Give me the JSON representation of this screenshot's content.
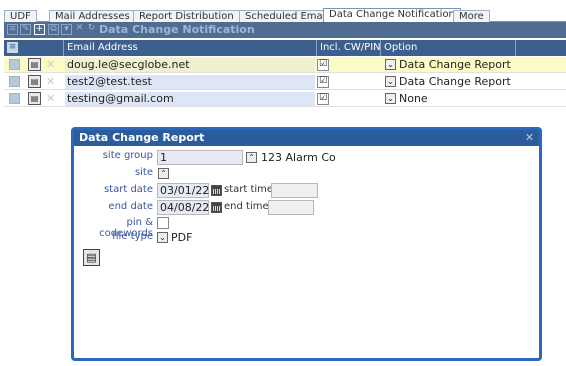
{
  "tabs": [
    {
      "label": "UDF",
      "active": false
    },
    {
      "label": "Mail Addresses",
      "active": false
    },
    {
      "label": "Report Distribution",
      "active": false
    },
    {
      "label": "Scheduled Email",
      "active": false
    },
    {
      "label": "Data Change Notification",
      "active": true
    },
    {
      "label": "More",
      "active": false
    }
  ],
  "toolbar": {
    "title": "Data Change Notification",
    "icons": [
      "list-icon",
      "edit-icon",
      "add-icon",
      "copy-icon",
      "filter-icon",
      "delete-icon",
      "refresh-icon"
    ]
  },
  "grid": {
    "columns": [
      "Email Address",
      "Incl. CW/PIN",
      "Option"
    ],
    "rows": [
      {
        "email": "doug.le@secglobe.net",
        "incl_cw_pin": "☑",
        "option": "Data Change Report",
        "selected": true
      },
      {
        "email": "test2@test.test",
        "incl_cw_pin": "☑",
        "option": "Data Change Report",
        "selected": false
      },
      {
        "email": "testing@gmail.com",
        "incl_cw_pin": "☑",
        "option": "None",
        "selected": false
      }
    ]
  },
  "dialog": {
    "title": "Data Change Report",
    "labels": {
      "site_group": "site group",
      "site": "site",
      "start_date": "start date",
      "start_time": "start time",
      "end_date": "end date",
      "end_time": "end time",
      "pin_codewords": "pin & codewords",
      "file_type": "file type"
    },
    "values": {
      "site_group": "1",
      "site_group_name": "123 Alarm Co",
      "start_date": "03/01/22",
      "end_date": "04/08/22",
      "start_time": "",
      "end_time": "",
      "file_type": "PDF"
    }
  },
  "colors": {
    "toolbar": "#4f6d93",
    "header": "#3d5f8d",
    "dialog_border": "#2b67bc",
    "selected_row": "#fbfbc6"
  }
}
